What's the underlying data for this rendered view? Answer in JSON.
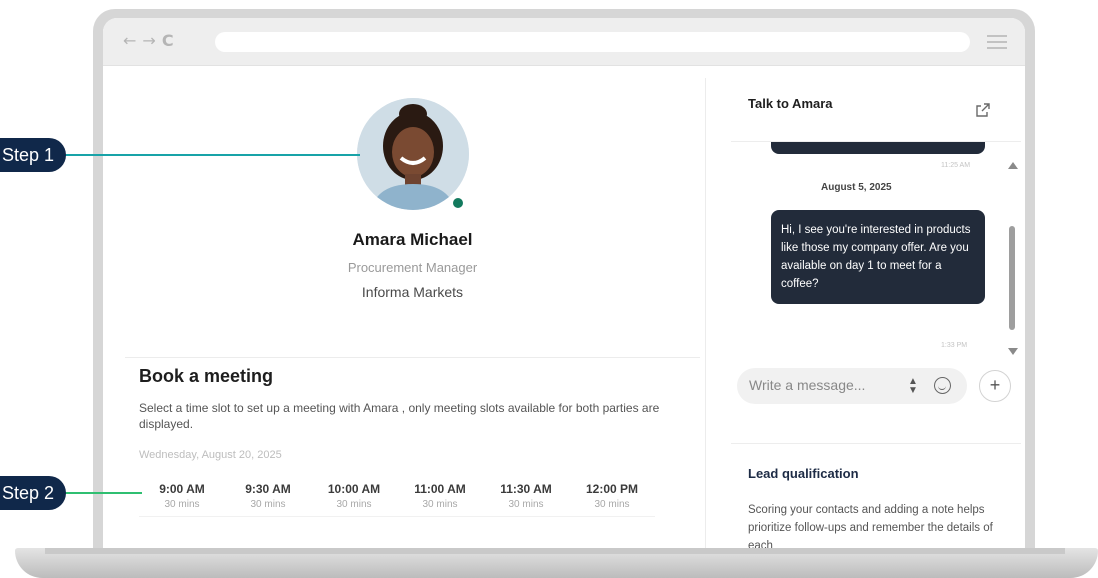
{
  "callouts": [
    {
      "label": "Step 1",
      "color": "#18a3a8"
    },
    {
      "label": "Step 2",
      "color": "#2fbf71"
    }
  ],
  "browser": {
    "back_icon": "arrow-left-icon",
    "forward_icon": "arrow-right-icon",
    "reload_icon": "reload-icon",
    "menu_icon": "hamburger-menu-icon"
  },
  "profile": {
    "name": "Amara Michael",
    "title": "Procurement Manager",
    "company": "Informa Markets",
    "status_color": "#137a5e"
  },
  "booking": {
    "heading": "Book a meeting",
    "description": "Select a time slot to set up a meeting with Amara , only meeting slots available for both parties are displayed.",
    "date": "Wednesday, August 20, 2025",
    "slots": [
      {
        "time": "9:00 AM",
        "duration": "30 mins"
      },
      {
        "time": "9:30 AM",
        "duration": "30 mins"
      },
      {
        "time": "10:00 AM",
        "duration": "30 mins"
      },
      {
        "time": "11:00 AM",
        "duration": "30 mins"
      },
      {
        "time": "11:30 AM",
        "duration": "30 mins"
      },
      {
        "time": "12:00 PM",
        "duration": "30 mins"
      }
    ]
  },
  "chat": {
    "title": "Talk to Amara",
    "prev_time": "11:25 AM",
    "date": "August 5, 2025",
    "message": "Hi, I see you're interested in products like those my company offer. Are you available on day 1 to meet for a coffee?",
    "message_time": "1:33 PM",
    "input_placeholder": "Write a message...",
    "plus_label": "+",
    "bubble_color": "#222b3a"
  },
  "lead": {
    "title": "Lead qualification",
    "description": "Scoring your contacts and adding a note helps prioritize follow-ups and remember the details of each"
  }
}
